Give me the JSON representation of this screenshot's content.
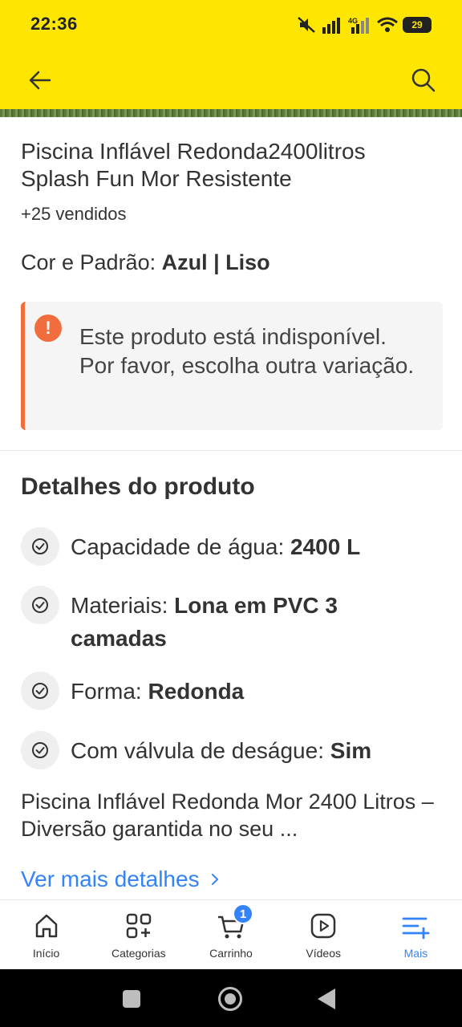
{
  "status_bar": {
    "time": "22:36",
    "battery": "29"
  },
  "header": {
    "back_icon": "arrow-left-icon",
    "search_icon": "search-icon"
  },
  "product": {
    "title": "Piscina Inflável Redonda2400litros Splash Fun Mor Resistente",
    "sold": "+25 vendidos",
    "variant_label": "Cor e Padrão:",
    "variant_value": "Azul | Liso"
  },
  "alert": {
    "icon": "!",
    "text": "Este produto está indisponível. Por favor, escolha outra variação.",
    "color": "#f26d3d"
  },
  "details": {
    "title": "Detalhes do produto",
    "specs": [
      {
        "label": "Capacidade de água:",
        "value": "2400 L"
      },
      {
        "label": "Materiais:",
        "value": "Lona em PVC 3 camadas"
      },
      {
        "label": "Forma:",
        "value": "Redonda"
      },
      {
        "label": "Com válvula de deságue:",
        "value": "Sim"
      }
    ],
    "description": "Piscina Inflável Redonda Mor 2400 Litros – Diversão garantida no seu ...",
    "more_link": "Ver mais detalhes"
  },
  "bottom_nav": {
    "items": [
      {
        "label": "Início",
        "icon": "home-icon"
      },
      {
        "label": "Categorias",
        "icon": "categories-icon"
      },
      {
        "label": "Carrinho",
        "icon": "cart-icon",
        "badge": "1"
      },
      {
        "label": "Vídeos",
        "icon": "video-icon"
      },
      {
        "label": "Mais",
        "icon": "menu-plus-icon",
        "active": true
      }
    ]
  },
  "colors": {
    "brand_yellow": "#FFE600",
    "accent_blue": "#3483fa",
    "warning_orange": "#f26d3d"
  }
}
